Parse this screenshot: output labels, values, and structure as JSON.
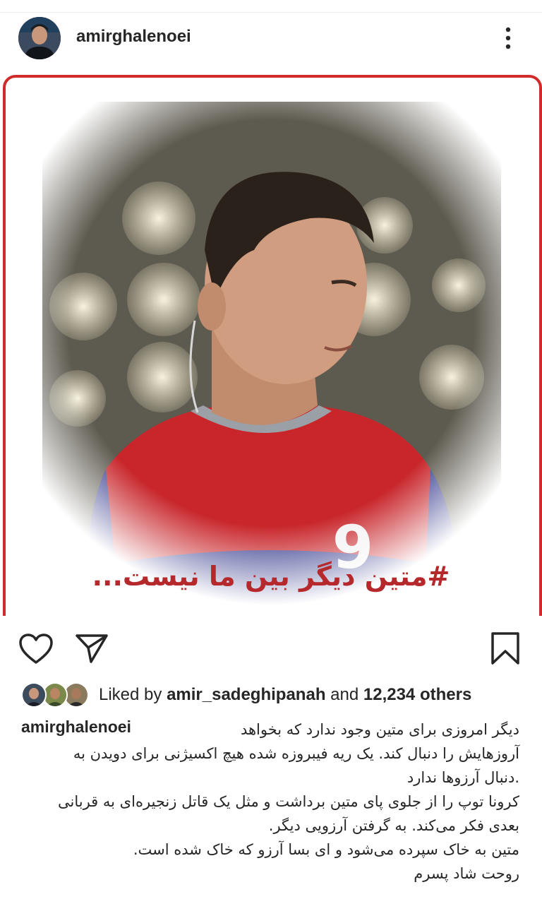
{
  "post": {
    "username": "amirghalenoei",
    "media_caption": "#متین دیگر بین ما نیست...",
    "jersey_number": "9"
  },
  "likes": {
    "prefix": "Liked by",
    "user": "amir_sadeghipanah",
    "connector": "and",
    "others": "12,234 others"
  },
  "caption": {
    "username": "amirghalenoei",
    "lines": [
      "دیگر امروزی برای متین وجود ندارد که بخواهد",
      "آروزهایش را دنبال کند. یک ریه فیبروزه شده هیچ اکسیژنی برای دویدن به",
      ".دنبال آرزوها ندارد",
      "کرونا توپ را از جلوی پای متین برداشت و مثل یک قاتل زنجیره‌ای به قربانی",
      "بعدی فکر می‌کند. به گرفتن آرزویی دیگر.",
      "متین به خاک سپرده می‌شود و ای بسا آرزو که خاک شده است.",
      "روحت شاد پسرم"
    ]
  },
  "icons": {
    "like": "heart-outline-icon",
    "share": "paper-plane-icon",
    "save": "bookmark-icon",
    "more": "vertical-dots-icon"
  },
  "colors": {
    "frame": "#d12a2a",
    "media_caption": "#b5282c",
    "jersey_red": "#c8262b",
    "jersey_blue": "#3a3f8f"
  }
}
